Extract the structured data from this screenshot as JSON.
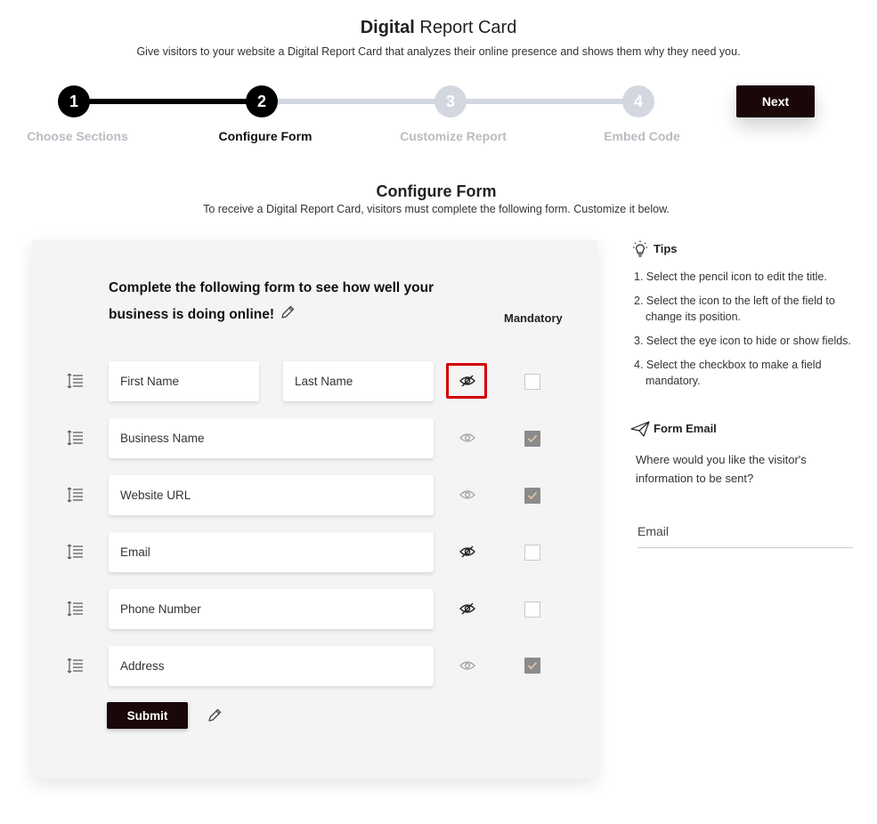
{
  "header": {
    "title_bold": "Digital",
    "title_rest": "Report Card",
    "subtitle": "Give visitors to your website a Digital Report Card that analyzes their online presence and shows them why they need you."
  },
  "stepper": {
    "steps": [
      {
        "number": "1",
        "label": "Choose Sections",
        "state": "done"
      },
      {
        "number": "2",
        "label": "Configure Form",
        "state": "current"
      },
      {
        "number": "3",
        "label": "Customize Report",
        "state": "todo"
      },
      {
        "number": "4",
        "label": "Embed Code",
        "state": "todo"
      }
    ],
    "next_label": "Next"
  },
  "section": {
    "title": "Configure Form",
    "description": "To receive a Digital Report Card, visitors must complete the following form. Customize it below."
  },
  "form": {
    "heading": "Complete the following form to see how well your business is doing online!",
    "mandatory_label": "Mandatory",
    "rows": [
      {
        "fields": [
          "First Name",
          "Last Name"
        ],
        "visible": false,
        "mandatory": false
      },
      {
        "fields": [
          "Business Name"
        ],
        "visible": true,
        "mandatory": true
      },
      {
        "fields": [
          "Website URL"
        ],
        "visible": true,
        "mandatory": true
      },
      {
        "fields": [
          "Email"
        ],
        "visible": false,
        "mandatory": false
      },
      {
        "fields": [
          "Phone Number"
        ],
        "visible": false,
        "mandatory": false
      },
      {
        "fields": [
          "Address"
        ],
        "visible": true,
        "mandatory": true
      }
    ],
    "submit_label": "Submit"
  },
  "tips": {
    "heading": "Tips",
    "items": [
      "1. Select the pencil icon to edit the title.",
      "2. Select the icon to the left of the field to change its position.",
      "3. Select the eye icon to hide or show fields.",
      "4. Select the checkbox to make a field mandatory."
    ]
  },
  "form_email": {
    "heading": "Form Email",
    "question": "Where would you like the visitor's information to be sent?",
    "placeholder": "Email"
  },
  "colors": {
    "primary_button": "#1a0707",
    "step_active": "#000000",
    "step_inactive": "#d3d7e0",
    "highlight": "#d10000",
    "card_bg": "#f4f4f4"
  },
  "icons": {
    "drag": "reorder-lines-icon",
    "eye": "eye-icon",
    "eye_hidden": "eye-slash-icon",
    "pencil": "pencil-icon",
    "tips": "lightbulb-icon",
    "email": "paper-plane-icon"
  }
}
